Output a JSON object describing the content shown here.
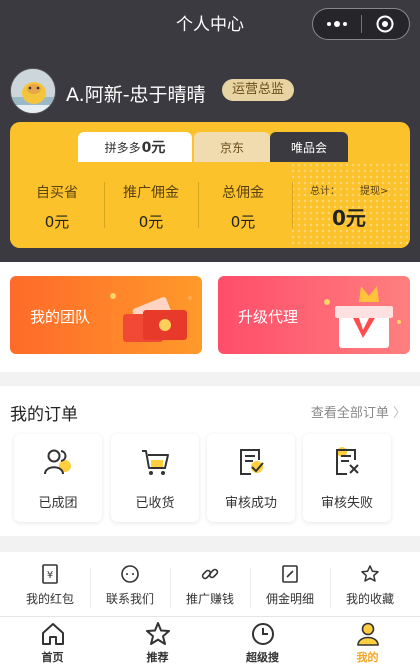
{
  "nav": {
    "title": "个人中心"
  },
  "profile": {
    "name": "A.阿新-忠于晴晴",
    "role": "运营总监"
  },
  "earnings": {
    "tabs": {
      "pdd_name": "拼多多",
      "pdd_amount": "0元",
      "jd": "京东",
      "vip": "唯品会"
    },
    "stats": [
      {
        "label": "自买省",
        "value": "0元"
      },
      {
        "label": "推广佣金",
        "value": "0元"
      },
      {
        "label": "总佣金",
        "value": "0元"
      }
    ],
    "total_label": "总计：",
    "withdraw": "提现>",
    "total_value": "0元"
  },
  "banners": {
    "team": "我的团队",
    "upgrade": "升级代理"
  },
  "orders": {
    "title": "我的订单",
    "view_all": "查看全部订单",
    "items": [
      {
        "label": "已成团",
        "icon": "group-icon"
      },
      {
        "label": "已收货",
        "icon": "cart-icon"
      },
      {
        "label": "审核成功",
        "icon": "approved-icon"
      },
      {
        "label": "审核失败",
        "icon": "rejected-icon"
      }
    ]
  },
  "tools": [
    {
      "label": "我的红包",
      "icon": "red-packet-icon"
    },
    {
      "label": "联系我们",
      "icon": "contact-icon"
    },
    {
      "label": "推广赚钱",
      "icon": "link-icon"
    },
    {
      "label": "佣金明细",
      "icon": "commission-detail-icon"
    },
    {
      "label": "我的收藏",
      "icon": "star-icon"
    }
  ],
  "tabbar": [
    {
      "label": "首页",
      "icon": "home-icon"
    },
    {
      "label": "推荐",
      "icon": "star-icon"
    },
    {
      "label": "超级搜",
      "icon": "clock-icon"
    },
    {
      "label": "我的",
      "icon": "person-icon"
    }
  ],
  "colors": {
    "header_bg": "#3b3a40",
    "card_bg": "#fbc22c",
    "accent": "#f5a623"
  }
}
